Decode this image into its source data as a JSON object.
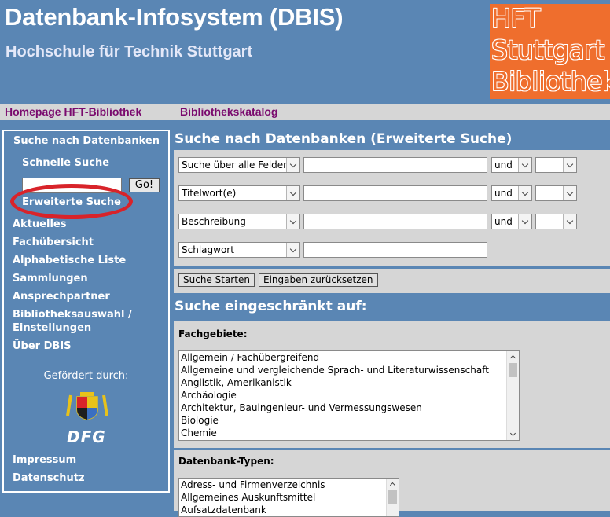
{
  "header": {
    "title": "Datenbank-Infosystem (DBIS)",
    "subtitle": "Hochschule für Technik Stuttgart",
    "logo_lines": [
      "HFT",
      "Stuttgart",
      "Bibliothek"
    ]
  },
  "nav": [
    "Homepage HFT-Bibliothek",
    "Bibliothekskatalog"
  ],
  "sidebar": {
    "search_heading": "Suche nach Datenbanken",
    "quick_search": "Schnelle Suche",
    "quick_search_value": "",
    "go_label": "Go!",
    "advanced_search": "Erweiterte Suche",
    "items": [
      "Aktuelles",
      "Fachübersicht",
      "Alphabetische Liste",
      "Sammlungen",
      "Ansprechpartner",
      "Bibliotheksauswahl /",
      "Einstellungen",
      "Über DBIS"
    ],
    "funded_by": "Gefördert durch:",
    "dfg_logo": "DFG",
    "footer": [
      "Impressum",
      "Datenschutz"
    ]
  },
  "search": {
    "heading": "Suche nach Datenbanken (Erweiterte Suche)",
    "rows": [
      {
        "field": "Suche über alle Felder",
        "value": "",
        "operator": "und",
        "extra": ""
      },
      {
        "field": "Titelwort(e)",
        "value": "",
        "operator": "und",
        "extra": ""
      },
      {
        "field": "Beschreibung",
        "value": "",
        "operator": "und",
        "extra": ""
      },
      {
        "field": "Schlagwort",
        "value": ""
      }
    ],
    "start_button": "Suche Starten",
    "reset_button": "Eingaben zurücksetzen"
  },
  "restrict": {
    "heading": "Suche eingeschränkt auf:",
    "subjects_label": "Fachgebiete:",
    "subjects": [
      "Allgemein / Fachübergreifend",
      "Allgemeine und vergleichende Sprach- und Literaturwissenschaft",
      "Anglistik, Amerikanistik",
      "Archäologie",
      "Architektur, Bauingenieur- und Vermessungswesen",
      "Biologie",
      "Chemie"
    ],
    "types_label": "Datenbank-Typen:",
    "types": [
      "Adress- und Firmenverzeichnis",
      "Allgemeines Auskunftsmittel",
      "Aufsatzdatenbank"
    ]
  },
  "colors": {
    "background": "#5a86b4",
    "nav_link": "#7a0a6e",
    "logo": "#ef6e2d",
    "highlight_oval": "#d8232a"
  }
}
